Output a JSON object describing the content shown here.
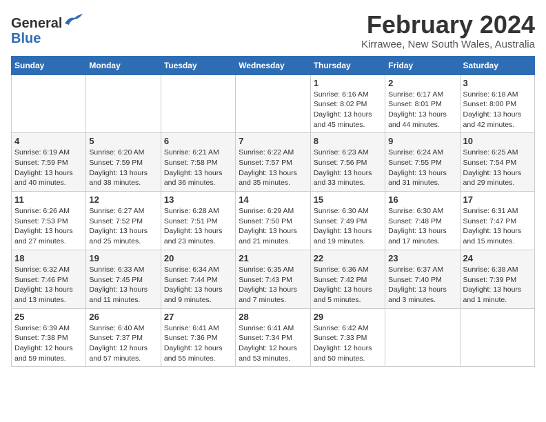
{
  "header": {
    "logo_line1": "General",
    "logo_line2": "Blue",
    "month_year": "February 2024",
    "location": "Kirrawee, New South Wales, Australia"
  },
  "weekdays": [
    "Sunday",
    "Monday",
    "Tuesday",
    "Wednesday",
    "Thursday",
    "Friday",
    "Saturday"
  ],
  "weeks": [
    [
      {
        "day": "",
        "detail": ""
      },
      {
        "day": "",
        "detail": ""
      },
      {
        "day": "",
        "detail": ""
      },
      {
        "day": "",
        "detail": ""
      },
      {
        "day": "1",
        "detail": "Sunrise: 6:16 AM\nSunset: 8:02 PM\nDaylight: 13 hours\nand 45 minutes."
      },
      {
        "day": "2",
        "detail": "Sunrise: 6:17 AM\nSunset: 8:01 PM\nDaylight: 13 hours\nand 44 minutes."
      },
      {
        "day": "3",
        "detail": "Sunrise: 6:18 AM\nSunset: 8:00 PM\nDaylight: 13 hours\nand 42 minutes."
      }
    ],
    [
      {
        "day": "4",
        "detail": "Sunrise: 6:19 AM\nSunset: 7:59 PM\nDaylight: 13 hours\nand 40 minutes."
      },
      {
        "day": "5",
        "detail": "Sunrise: 6:20 AM\nSunset: 7:59 PM\nDaylight: 13 hours\nand 38 minutes."
      },
      {
        "day": "6",
        "detail": "Sunrise: 6:21 AM\nSunset: 7:58 PM\nDaylight: 13 hours\nand 36 minutes."
      },
      {
        "day": "7",
        "detail": "Sunrise: 6:22 AM\nSunset: 7:57 PM\nDaylight: 13 hours\nand 35 minutes."
      },
      {
        "day": "8",
        "detail": "Sunrise: 6:23 AM\nSunset: 7:56 PM\nDaylight: 13 hours\nand 33 minutes."
      },
      {
        "day": "9",
        "detail": "Sunrise: 6:24 AM\nSunset: 7:55 PM\nDaylight: 13 hours\nand 31 minutes."
      },
      {
        "day": "10",
        "detail": "Sunrise: 6:25 AM\nSunset: 7:54 PM\nDaylight: 13 hours\nand 29 minutes."
      }
    ],
    [
      {
        "day": "11",
        "detail": "Sunrise: 6:26 AM\nSunset: 7:53 PM\nDaylight: 13 hours\nand 27 minutes."
      },
      {
        "day": "12",
        "detail": "Sunrise: 6:27 AM\nSunset: 7:52 PM\nDaylight: 13 hours\nand 25 minutes."
      },
      {
        "day": "13",
        "detail": "Sunrise: 6:28 AM\nSunset: 7:51 PM\nDaylight: 13 hours\nand 23 minutes."
      },
      {
        "day": "14",
        "detail": "Sunrise: 6:29 AM\nSunset: 7:50 PM\nDaylight: 13 hours\nand 21 minutes."
      },
      {
        "day": "15",
        "detail": "Sunrise: 6:30 AM\nSunset: 7:49 PM\nDaylight: 13 hours\nand 19 minutes."
      },
      {
        "day": "16",
        "detail": "Sunrise: 6:30 AM\nSunset: 7:48 PM\nDaylight: 13 hours\nand 17 minutes."
      },
      {
        "day": "17",
        "detail": "Sunrise: 6:31 AM\nSunset: 7:47 PM\nDaylight: 13 hours\nand 15 minutes."
      }
    ],
    [
      {
        "day": "18",
        "detail": "Sunrise: 6:32 AM\nSunset: 7:46 PM\nDaylight: 13 hours\nand 13 minutes."
      },
      {
        "day": "19",
        "detail": "Sunrise: 6:33 AM\nSunset: 7:45 PM\nDaylight: 13 hours\nand 11 minutes."
      },
      {
        "day": "20",
        "detail": "Sunrise: 6:34 AM\nSunset: 7:44 PM\nDaylight: 13 hours\nand 9 minutes."
      },
      {
        "day": "21",
        "detail": "Sunrise: 6:35 AM\nSunset: 7:43 PM\nDaylight: 13 hours\nand 7 minutes."
      },
      {
        "day": "22",
        "detail": "Sunrise: 6:36 AM\nSunset: 7:42 PM\nDaylight: 13 hours\nand 5 minutes."
      },
      {
        "day": "23",
        "detail": "Sunrise: 6:37 AM\nSunset: 7:40 PM\nDaylight: 13 hours\nand 3 minutes."
      },
      {
        "day": "24",
        "detail": "Sunrise: 6:38 AM\nSunset: 7:39 PM\nDaylight: 13 hours\nand 1 minute."
      }
    ],
    [
      {
        "day": "25",
        "detail": "Sunrise: 6:39 AM\nSunset: 7:38 PM\nDaylight: 12 hours\nand 59 minutes."
      },
      {
        "day": "26",
        "detail": "Sunrise: 6:40 AM\nSunset: 7:37 PM\nDaylight: 12 hours\nand 57 minutes."
      },
      {
        "day": "27",
        "detail": "Sunrise: 6:41 AM\nSunset: 7:36 PM\nDaylight: 12 hours\nand 55 minutes."
      },
      {
        "day": "28",
        "detail": "Sunrise: 6:41 AM\nSunset: 7:34 PM\nDaylight: 12 hours\nand 53 minutes."
      },
      {
        "day": "29",
        "detail": "Sunrise: 6:42 AM\nSunset: 7:33 PM\nDaylight: 12 hours\nand 50 minutes."
      },
      {
        "day": "",
        "detail": ""
      },
      {
        "day": "",
        "detail": ""
      }
    ]
  ]
}
